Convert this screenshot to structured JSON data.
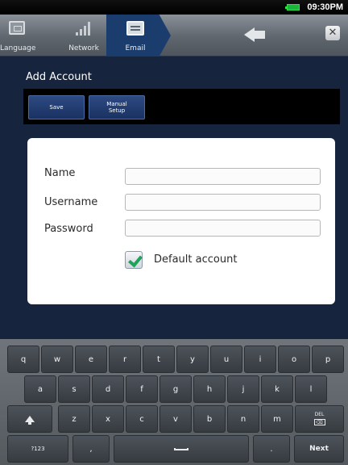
{
  "status_bar": {
    "time": "09:30PM",
    "battery_color": "#2ee24c"
  },
  "wizard": {
    "steps": [
      {
        "label": "Language",
        "icon": "language-icon"
      },
      {
        "label": "Network",
        "icon": "network-signal-icon"
      },
      {
        "label": "Email",
        "icon": "email-icon",
        "active": true
      }
    ],
    "back_icon": "back-arrow-icon",
    "close_icon": "close-icon",
    "close_glyph": "✕"
  },
  "page": {
    "title": "Add Account",
    "buttons": {
      "save": "Save",
      "manual_setup": "Manual\nSetup"
    }
  },
  "form": {
    "name_label": "Name",
    "name_value": "",
    "username_label": "Username",
    "username_value": "",
    "password_label": "Password",
    "password_value": "",
    "default_account_label": "Default account",
    "default_account_checked": true
  },
  "keyboard": {
    "row1": [
      "q",
      "w",
      "e",
      "r",
      "t",
      "y",
      "u",
      "i",
      "o",
      "p"
    ],
    "row2": [
      "a",
      "s",
      "d",
      "f",
      "g",
      "h",
      "j",
      "k",
      "l"
    ],
    "row3": [
      "z",
      "x",
      "c",
      "v",
      "b",
      "n",
      "m"
    ],
    "delete_top": "DEL",
    "delete_box": "⌫",
    "symbols": "?123",
    "comma": ",",
    "period": ".",
    "next": "Next"
  },
  "colors": {
    "background": "#16253d",
    "accent": "#1b3d6e",
    "button": "#2d4a82",
    "check": "#1fa35a"
  }
}
